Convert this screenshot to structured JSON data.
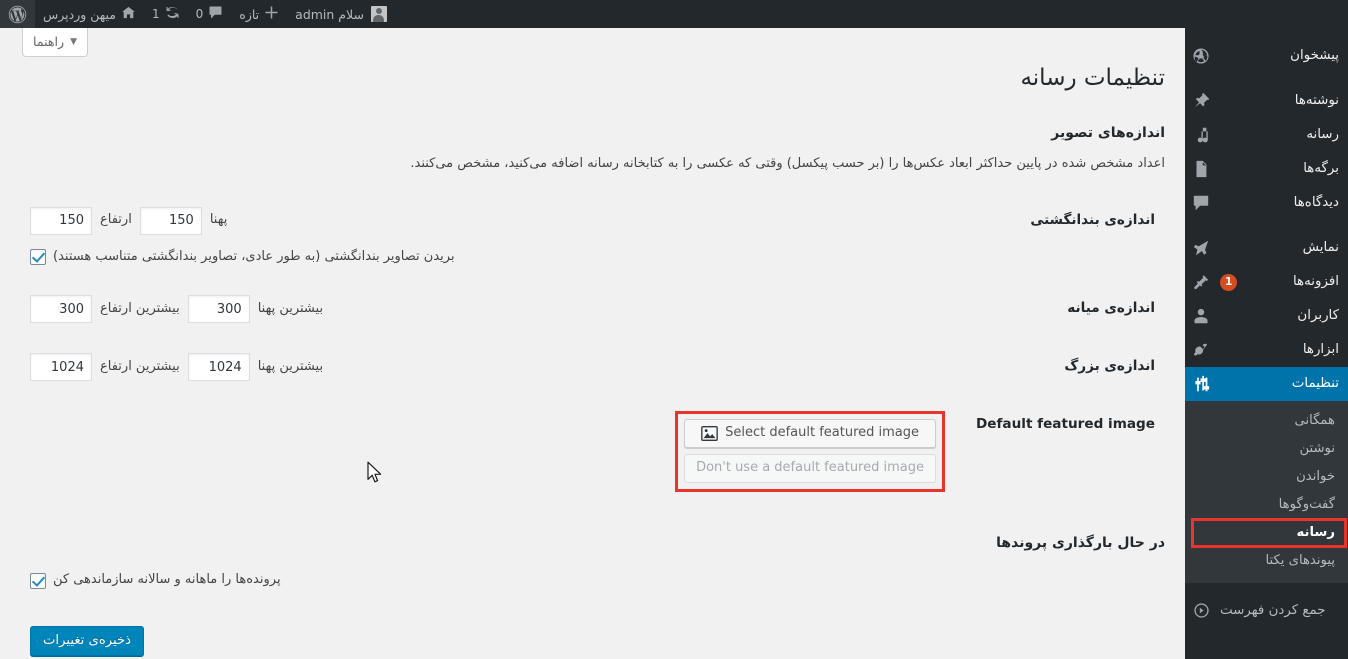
{
  "adminbar": {
    "logo_icon": "wordpress-logo-icon",
    "site": {
      "icon": "home-icon",
      "label": "میهن وردپرس"
    },
    "updates": {
      "icon": "updates-icon",
      "count": "1"
    },
    "comments": {
      "icon": "comment-bubble-icon",
      "count": "0"
    },
    "new": {
      "icon": "plus-icon",
      "label": "تازه"
    },
    "howdy": {
      "label": "سلام admin",
      "avatar": "avatar-icon"
    }
  },
  "help_tab": {
    "label": "راهنما",
    "caret": "▼"
  },
  "sidebar": {
    "items": [
      {
        "label": "پیشخوان",
        "icon": "dashboard-icon",
        "name": "dashboard"
      },
      {
        "label": "نوشته‌ها",
        "icon": "pin-icon",
        "name": "posts"
      },
      {
        "label": "رسانه",
        "icon": "media-icon",
        "name": "media"
      },
      {
        "label": "برگه‌ها",
        "icon": "page-icon",
        "name": "pages"
      },
      {
        "label": "دیدگاه‌ها",
        "icon": "comment-icon",
        "name": "comments"
      },
      {
        "label": "نمایش",
        "icon": "appearance-icon",
        "name": "appearance"
      },
      {
        "label": "افزونه‌ها",
        "icon": "plugins-icon",
        "name": "plugins",
        "badge": "1"
      },
      {
        "label": "کاربران",
        "icon": "users-icon",
        "name": "users"
      },
      {
        "label": "ابزارها",
        "icon": "tools-icon",
        "name": "tools"
      },
      {
        "label": "تنظیمات",
        "icon": "settings-icon",
        "name": "settings",
        "current": true
      }
    ],
    "submenu": [
      {
        "label": "همگانی",
        "name": "general"
      },
      {
        "label": "نوشتن",
        "name": "writing"
      },
      {
        "label": "خواندن",
        "name": "reading"
      },
      {
        "label": "گفت‌وگوها",
        "name": "discussion"
      },
      {
        "label": "رسانه",
        "name": "media",
        "current": true
      },
      {
        "label": "پیوندهای یکتا",
        "name": "permalinks"
      }
    ],
    "collapse": {
      "label": "جمع کردن فهرست",
      "icon": "collapse-icon"
    }
  },
  "page": {
    "title": "تنظیمات رسانه",
    "image_sizes_heading": "اندازه‌های تصویر",
    "image_sizes_description": "اعداد مشخص شده در پایین حداکثر ابعاد عکس‌ها را (بر حسب پیکسل) وقتی که عکسی را به کتابخانه رسانه اضافه می‌کنید، مشخص می‌کنند.",
    "rows": {
      "thumbnail": {
        "label": "اندازه‌ی بندانگشتی",
        "width_label": "پهنا",
        "width_value": "150",
        "height_label": "ارتفاع",
        "height_value": "150",
        "crop_label": "بریدن تصاویر بندانگشتی (به طور عادی، تصاویر بندانگشتی متناسب هستند)",
        "crop_checked": true
      },
      "medium": {
        "label": "اندازه‌ی میانه",
        "width_label": "بیشترین پهنا",
        "width_value": "300",
        "height_label": "بیشترین ارتفاع",
        "height_value": "300"
      },
      "large": {
        "label": "اندازه‌ی بزرگ",
        "width_label": "بیشترین پهنا",
        "width_value": "1024",
        "height_label": "بیشترین ارتفاع",
        "height_value": "1024"
      },
      "default_featured_image": {
        "label": "Default featured image",
        "select_button": "Select default featured image",
        "select_button_icon": "image-icon",
        "remove_button": "Don't use a default featured image",
        "highlight_color": "#e8342b"
      }
    },
    "uploading_heading": "در حال بارگذاری پروندها",
    "organize_label": "پرونده‌ها را ماهانه و سالانه سازماندهی کن",
    "organize_checked": true,
    "save_button": "ذخیره‌ی تغییرات"
  },
  "colors": {
    "admin_dark": "#23282d",
    "submenu_bg": "#32373c",
    "accent_blue": "#0073aa",
    "primary_button": "#0085ba",
    "page_bg": "#f1f1f1",
    "highlight_red": "#e8342b",
    "badge_orange": "#d54e21"
  }
}
